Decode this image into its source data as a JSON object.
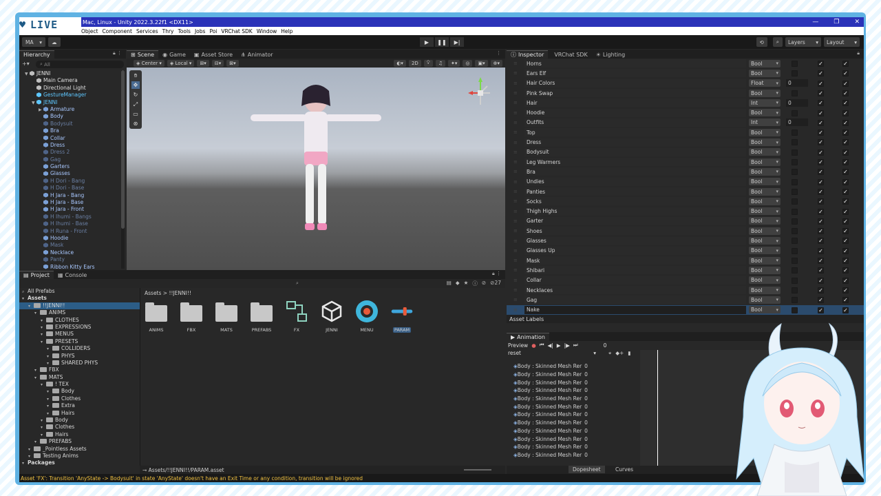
{
  "stream": {
    "live_label": "LIVE"
  },
  "titlebar": {
    "title": "Mac, Linux - Unity 2022.3.22f1 <DX11>"
  },
  "menu": [
    "Object",
    "Component",
    "Services",
    "Thry",
    "Tools",
    "Jobs",
    "Poi",
    "VRChat SDK",
    "Window",
    "Help"
  ],
  "toolbar": {
    "account": "MA",
    "layers": "Layers",
    "layout": "Layout"
  },
  "hierarchy": {
    "tab": "Hierarchy",
    "search_placeholder": "All",
    "items": [
      {
        "label": "JENNI",
        "style": "white",
        "indent": 0
      },
      {
        "label": "Main Camera",
        "style": "white",
        "indent": 1
      },
      {
        "label": "Directional Light",
        "style": "white",
        "indent": 1
      },
      {
        "label": "GestureManager",
        "style": "cyan",
        "indent": 1
      },
      {
        "label": "JENNI",
        "style": "cyan",
        "indent": 1
      },
      {
        "label": "Armature",
        "style": "blue",
        "indent": 2
      },
      {
        "label": "Body",
        "style": "blue",
        "indent": 2
      },
      {
        "label": "Bodysuit",
        "style": "dim",
        "indent": 2
      },
      {
        "label": "Bra",
        "style": "blue",
        "indent": 2
      },
      {
        "label": "Collar",
        "style": "blue",
        "indent": 2
      },
      {
        "label": "Dress",
        "style": "blue",
        "indent": 2
      },
      {
        "label": "Dress 2",
        "style": "dim",
        "indent": 2
      },
      {
        "label": "Gag",
        "style": "dim",
        "indent": 2
      },
      {
        "label": "Garters",
        "style": "blue",
        "indent": 2
      },
      {
        "label": "Glasses",
        "style": "blue",
        "indent": 2
      },
      {
        "label": "H Dori - Bang",
        "style": "dim",
        "indent": 2
      },
      {
        "label": "H Dori - Base",
        "style": "dim",
        "indent": 2
      },
      {
        "label": "H Jara - Bang",
        "style": "blue",
        "indent": 2
      },
      {
        "label": "H Jara - Base",
        "style": "blue",
        "indent": 2
      },
      {
        "label": "H Jara - Front",
        "style": "blue",
        "indent": 2
      },
      {
        "label": "H Ihumi - Bangs",
        "style": "dim",
        "indent": 2
      },
      {
        "label": "H Ihumi - Base",
        "style": "dim",
        "indent": 2
      },
      {
        "label": "H Runa - Front",
        "style": "dim",
        "indent": 2
      },
      {
        "label": "Hoodie",
        "style": "blue",
        "indent": 2
      },
      {
        "label": "Mask",
        "style": "dim",
        "indent": 2
      },
      {
        "label": "Necklace",
        "style": "blue",
        "indent": 2
      },
      {
        "label": "Panty",
        "style": "dim",
        "indent": 2
      },
      {
        "label": "Ribbon Kitty Ears",
        "style": "blue",
        "indent": 2
      }
    ]
  },
  "scene": {
    "tabs": [
      "Scene",
      "Game",
      "Asset Store",
      "Animator"
    ],
    "pivot": "Center",
    "space": "Local",
    "mode_2d": "2D"
  },
  "project": {
    "tabs": [
      "Project",
      "Console"
    ],
    "asset_count": "27",
    "breadcrumb": "Assets > !!JENNI!!",
    "tree": [
      {
        "label": "All Prefabs",
        "indent": 0,
        "kind": "search"
      },
      {
        "label": "Assets",
        "indent": 0,
        "kind": "bold"
      },
      {
        "label": "!!JENNI!!",
        "indent": 1,
        "kind": "sel"
      },
      {
        "label": "ANIMS",
        "indent": 2
      },
      {
        "label": "CLOTHES",
        "indent": 3
      },
      {
        "label": "EXPRESSIONS",
        "indent": 3
      },
      {
        "label": "MENUS",
        "indent": 3
      },
      {
        "label": "PRESETS",
        "indent": 3
      },
      {
        "label": "COLLIDERS",
        "indent": 4
      },
      {
        "label": "PHYS",
        "indent": 4
      },
      {
        "label": "SHARED PHYS",
        "indent": 4
      },
      {
        "label": "FBX",
        "indent": 2
      },
      {
        "label": "MATS",
        "indent": 2
      },
      {
        "label": "! TEX",
        "indent": 3
      },
      {
        "label": "Body",
        "indent": 4
      },
      {
        "label": "Clothes",
        "indent": 4
      },
      {
        "label": "Extra",
        "indent": 4
      },
      {
        "label": "Hairs",
        "indent": 4
      },
      {
        "label": "Body",
        "indent": 3
      },
      {
        "label": "Clothes",
        "indent": 3
      },
      {
        "label": "Hairs",
        "indent": 3
      },
      {
        "label": "PREFABS",
        "indent": 2
      },
      {
        "label": "_Pointless Assets",
        "indent": 1
      },
      {
        "label": "Testing Anims",
        "indent": 1
      },
      {
        "label": "Packages",
        "indent": 0,
        "kind": "bold"
      }
    ],
    "assets": [
      {
        "label": "ANIMS",
        "kind": "folder"
      },
      {
        "label": "FBX",
        "kind": "folder"
      },
      {
        "label": "MATS",
        "kind": "folder"
      },
      {
        "label": "PREFABS",
        "kind": "folder"
      },
      {
        "label": "FX",
        "kind": "fx"
      },
      {
        "label": "JENNI",
        "kind": "unity"
      },
      {
        "label": "MENU",
        "kind": "menu"
      },
      {
        "label": "PARAM",
        "kind": "param"
      }
    ],
    "path": "Assets/!!JENNI!!/PARAM.asset"
  },
  "inspector": {
    "tabs": [
      "Inspector",
      "VRChat SDK",
      "Lighting"
    ],
    "params": [
      {
        "name": "Horns",
        "type": "Bool",
        "def": ""
      },
      {
        "name": "Ears Elf",
        "type": "Bool",
        "def": ""
      },
      {
        "name": "Hair Colors",
        "type": "Float",
        "def": "0"
      },
      {
        "name": "Pink Swap",
        "type": "Bool",
        "def": ""
      },
      {
        "name": "Hair",
        "type": "Int",
        "def": "0"
      },
      {
        "name": "Hoodie",
        "type": "Bool",
        "def": ""
      },
      {
        "name": "Outfits",
        "type": "Int",
        "def": "0"
      },
      {
        "name": "Top",
        "type": "Bool",
        "def": ""
      },
      {
        "name": "Dress",
        "type": "Bool",
        "def": ""
      },
      {
        "name": "Bodysuit",
        "type": "Bool",
        "def": ""
      },
      {
        "name": "Leg Warmers",
        "type": "Bool",
        "def": ""
      },
      {
        "name": "Bra",
        "type": "Bool",
        "def": ""
      },
      {
        "name": "Undies",
        "type": "Bool",
        "def": ""
      },
      {
        "name": "Panties",
        "type": "Bool",
        "def": ""
      },
      {
        "name": "Socks",
        "type": "Bool",
        "def": ""
      },
      {
        "name": "Thigh Highs",
        "type": "Bool",
        "def": ""
      },
      {
        "name": "Garter",
        "type": "Bool",
        "def": ""
      },
      {
        "name": "Shoes",
        "type": "Bool",
        "def": ""
      },
      {
        "name": "Glasses",
        "type": "Bool",
        "def": ""
      },
      {
        "name": "Glasses Up",
        "type": "Bool",
        "def": ""
      },
      {
        "name": "Mask",
        "type": "Bool",
        "def": ""
      },
      {
        "name": "Shibari",
        "type": "Bool",
        "def": ""
      },
      {
        "name": "Collar",
        "type": "Bool",
        "def": ""
      },
      {
        "name": "Necklaces",
        "type": "Bool",
        "def": ""
      },
      {
        "name": "Gag",
        "type": "Bool",
        "def": ""
      },
      {
        "name": "Nake",
        "type": "Bool",
        "def": "",
        "selected": true
      }
    ],
    "asset_labels": "Asset Labels"
  },
  "animation": {
    "tab": "Animation",
    "preview": "Preview",
    "frame": "0",
    "clip": "reset",
    "rows_label": "Body : Skinned Mesh Rer",
    "row_value": "0",
    "row_count": 12,
    "dopesheet": "Dopesheet",
    "curves": "Curves"
  },
  "status": {
    "message": "Asset 'FX': Transition 'AnyState -> Bodysuit' in state 'AnyState' doesn't have an Exit Time or any condition, transition will be ignored"
  },
  "colors": {
    "frame": "#5fb2e3",
    "titlebar": "#2a32b8",
    "selection": "#2c5d87",
    "warning": "#f0c040"
  }
}
